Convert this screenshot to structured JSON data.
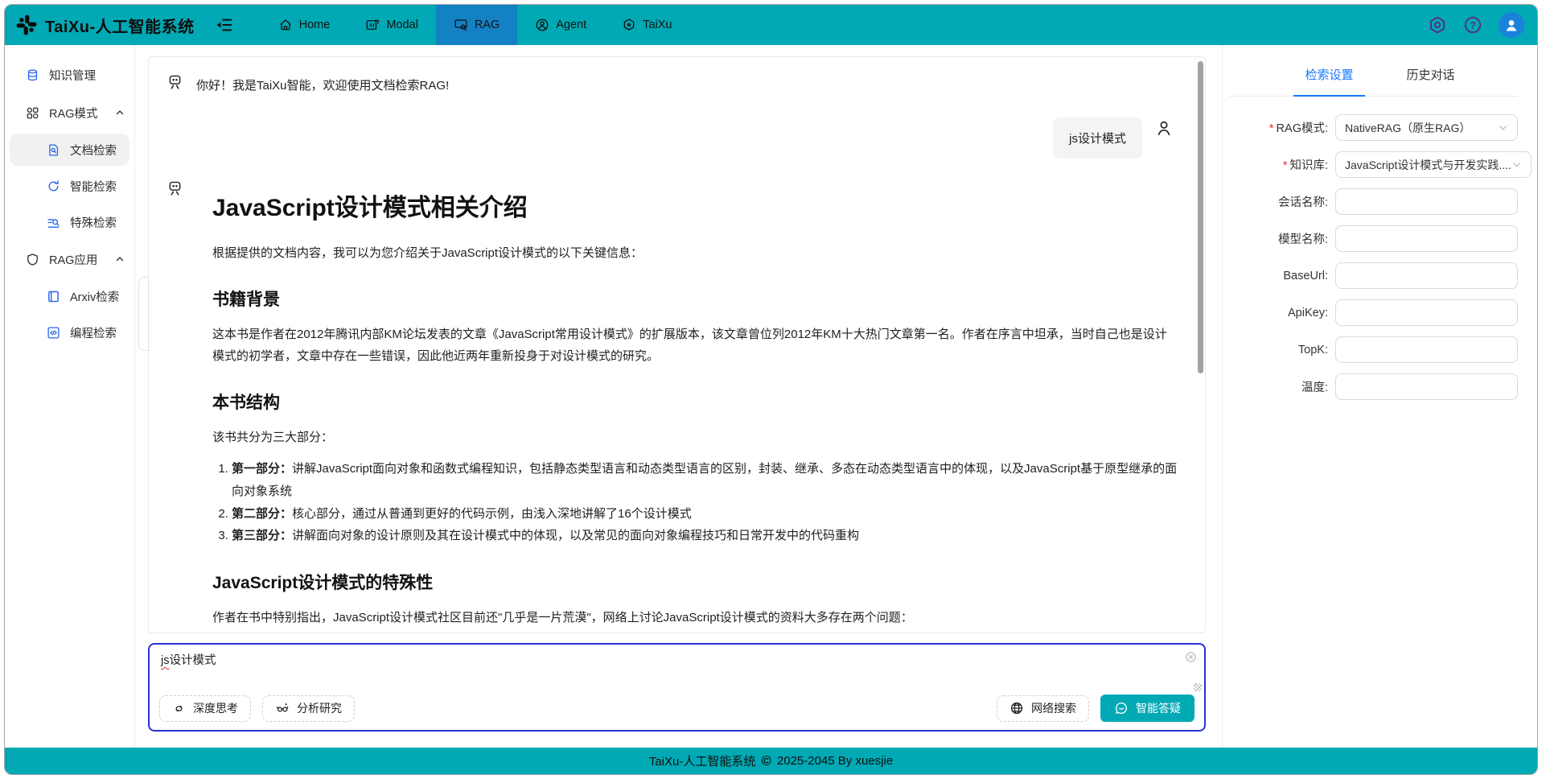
{
  "colors": {
    "teal": "#00A9B4",
    "nav_active_blue": "#1581C5",
    "accent_blue": "#1677ff",
    "sidebar_icon_blue": "#2563eb",
    "composer_border_blue": "#2b2fd8",
    "avatar_blue": "#1A82D9",
    "header_icon_purple": "#5B2A86",
    "required_red": "#f5222d"
  },
  "header": {
    "title": "TaiXu-人工智能系统",
    "nav": [
      {
        "label": "Home"
      },
      {
        "label": "Modal"
      },
      {
        "label": "RAG",
        "active": true
      },
      {
        "label": "Agent"
      },
      {
        "label": "TaiXu"
      }
    ]
  },
  "sidebar": {
    "items": [
      {
        "label": "知识管理"
      },
      {
        "label": "RAG模式"
      },
      {
        "label": "文档检索",
        "active": true
      },
      {
        "label": "智能检索"
      },
      {
        "label": "特殊检索"
      },
      {
        "label": "RAG应用"
      },
      {
        "label": "Arxiv检索"
      },
      {
        "label": "编程检索"
      }
    ]
  },
  "chat": {
    "welcome": "你好！我是TaiXu智能，欢迎使用文档检索RAG!",
    "user_message": "js设计模式",
    "answer": {
      "h1": "JavaScript设计模式相关介绍",
      "intro": "根据提供的文档内容，我可以为您介绍关于JavaScript设计模式的以下关键信息：",
      "s1_title": "书籍背景",
      "s1_body": "这本书是作者在2012年腾讯内部KM论坛发表的文章《JavaScript常用设计模式》的扩展版本，该文章曾位列2012年KM十大热门文章第一名。作者在序言中坦承，当时自己也是设计模式的初学者，文章中存在一些错误，因此他近两年重新投身于对设计模式的研究。",
      "s2_title": "本书结构",
      "s2_body": "该书共分为三大部分：",
      "list": [
        {
          "bold": "第一部分：",
          "text": "讲解JavaScript面向对象和函数式编程知识，包括静态类型语言和动态类型语言的区别，封装、继承、多态在动态类型语言中的体现，以及JavaScript基于原型继承的面向对象系统"
        },
        {
          "bold": "第二部分：",
          "text": "核心部分，通过从普通到更好的代码示例，由浅入深地讲解了16个设计模式"
        },
        {
          "bold": "第三部分：",
          "text": "讲解面向对象的设计原则及其在设计模式中的体现，以及常见的面向对象编程技巧和日常开发中的代码重构"
        }
      ],
      "s3_title": "JavaScript设计模式的特殊性",
      "s3_body": "作者在书中特别指出，JavaScript设计模式社区目前还\"几乎是一片荒漠\"，网络上讨论JavaScript设计模式的资料大多存在两个问题："
    }
  },
  "composer": {
    "value": "js设计模式",
    "flagged": "js",
    "rest": "设计模式",
    "buttons": [
      {
        "label": "深度思考"
      },
      {
        "label": "分析研究"
      },
      {
        "label": "网络搜索"
      },
      {
        "label": "智能答疑"
      }
    ]
  },
  "panel": {
    "tabs": [
      {
        "label": "检索设置",
        "active": true
      },
      {
        "label": "历史对话"
      }
    ],
    "required_marker": "*",
    "fields": [
      {
        "label": "RAG模式:",
        "required": true,
        "type": "select",
        "value": "NativeRAG（原生RAG）"
      },
      {
        "label": "知识库:",
        "required": true,
        "type": "select",
        "value": "JavaScript设计模式与开发实践...."
      },
      {
        "label": "会话名称:",
        "value": ""
      },
      {
        "label": "模型名称:",
        "value": ""
      },
      {
        "label": "BaseUrl:",
        "value": ""
      },
      {
        "label": "ApiKey:",
        "value": ""
      },
      {
        "label": "TopK:",
        "value": ""
      },
      {
        "label": "温度:",
        "value": ""
      }
    ]
  },
  "footer": {
    "brand": "TaiXu-人工智能系统",
    "symbol": "©",
    "text": "2025-2045 By xuesjie"
  },
  "icons": {
    "logo": "slack-style-pinwheel-mark",
    "collapse": "menu-unfold",
    "home": "house",
    "modal": "ai-box",
    "rag": "window-magnifier",
    "agent": "person-circle",
    "taixu": "hexagon-badge",
    "settings": "hexagon-gear",
    "help": "question-circle",
    "avatar": "user-bust",
    "bot": "robot-face",
    "user": "person-outline",
    "deep_think": "knot-loop",
    "analyze": "glasses-sparkle",
    "web_search": "globe",
    "smart_answer": "chat-smile",
    "clear": "circle-x",
    "copyright": "©"
  }
}
